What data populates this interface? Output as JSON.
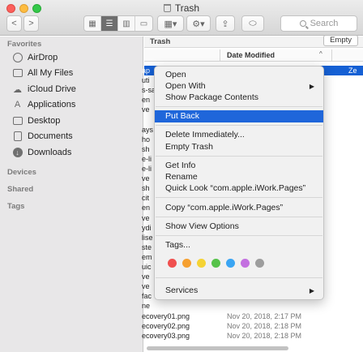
{
  "window": {
    "title": "Trash"
  },
  "toolbar": {
    "back_label": "<",
    "forward_label": ">",
    "arrange_label": "▦▾",
    "action_label": "⚙▾",
    "search_placeholder": "Search"
  },
  "sidebar": {
    "favorites_header": "Favorites",
    "items": [
      {
        "label": "AirDrop",
        "icon": "airdrop-icon"
      },
      {
        "label": "All My Files",
        "icon": "all-files-icon"
      },
      {
        "label": "iCloud Drive",
        "icon": "icloud-icon"
      },
      {
        "label": "Applications",
        "icon": "applications-icon"
      },
      {
        "label": "Desktop",
        "icon": "desktop-icon"
      },
      {
        "label": "Documents",
        "icon": "documents-icon"
      },
      {
        "label": "Downloads",
        "icon": "downloads-icon"
      }
    ],
    "devices_header": "Devices",
    "shared_header": "Shared",
    "tags_header": "Tags"
  },
  "content": {
    "path_label": "Trash",
    "empty_button": "Empty",
    "column_date": "Date Modified",
    "sort_indicator": "^",
    "rows": [
      {
        "name": "ap",
        "date": "Ze",
        "selected": true
      },
      {
        "name": "uti",
        "date": ""
      },
      {
        "name": "s-sa",
        "date": ""
      },
      {
        "name": "en",
        "date": ""
      },
      {
        "name": "ve",
        "date": ""
      },
      {
        "name": "",
        "date": ""
      },
      {
        "name": "ays",
        "date": ""
      },
      {
        "name": "ho",
        "date": ""
      },
      {
        "name": "sh",
        "date": ""
      },
      {
        "name": "e-li",
        "date": ""
      },
      {
        "name": "e-li",
        "date": ""
      },
      {
        "name": "ve",
        "date": ""
      },
      {
        "name": "sh",
        "date": ""
      },
      {
        "name": "cit",
        "date": ""
      },
      {
        "name": "en",
        "date": ""
      },
      {
        "name": "ve",
        "date": ""
      },
      {
        "name": "ydi",
        "date": ""
      },
      {
        "name": "lise",
        "date": ""
      },
      {
        "name": "ste",
        "date": ""
      },
      {
        "name": "em",
        "date": ""
      },
      {
        "name": "uic",
        "date": ""
      },
      {
        "name": "ve",
        "date": ""
      },
      {
        "name": "ve",
        "date": ""
      },
      {
        "name": "fac",
        "date": ""
      },
      {
        "name": "ne",
        "date": ""
      },
      {
        "name": "ecovery01.png",
        "date": "Nov 20, 2018, 2:17 PM"
      },
      {
        "name": "ecovery02.png",
        "date": "Nov 20, 2018, 2:18 PM"
      },
      {
        "name": "ecovery03.png",
        "date": "Nov 20, 2018, 2:18 PM"
      }
    ]
  },
  "context_menu": {
    "items": {
      "open": "Open",
      "open_with": "Open With",
      "show_package": "Show Package Contents",
      "put_back": "Put Back",
      "delete": "Delete Immediately...",
      "empty_trash": "Empty Trash",
      "get_info": "Get Info",
      "rename": "Rename",
      "quick_look": "Quick Look “com.apple.iWork.Pages”",
      "copy": "Copy “com.apple.iWork.Pages”",
      "show_view_options": "Show View Options",
      "tags": "Tags...",
      "services": "Services"
    },
    "submenu_arrow": "▶",
    "tag_colors": [
      "#f0504f",
      "#f6a030",
      "#f5d334",
      "#56c24a",
      "#3aa5f3",
      "#c370e0",
      "#9d9d9d"
    ]
  }
}
